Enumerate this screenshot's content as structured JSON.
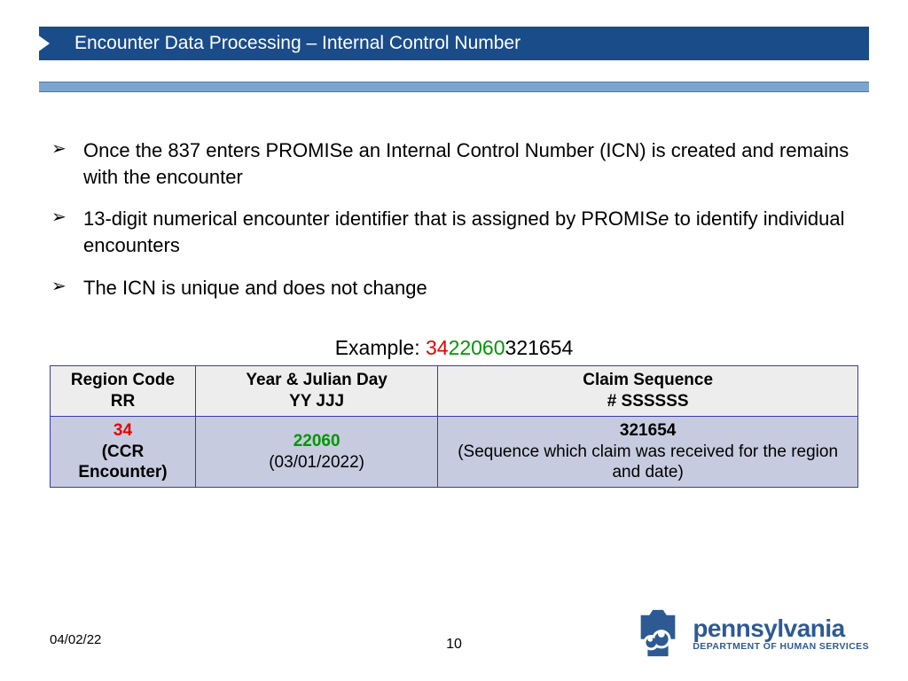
{
  "header": {
    "title": "Encounter Data Processing – Internal Control Number"
  },
  "bullets": {
    "b1": "Once the 837 enters PROMISe an Internal Control Number (ICN) is created and remains with the encounter",
    "b2a": "13-digit numerical encounter identifier that is assigned by PROMIS",
    "b2b": "e",
    "b2c": " to identify individual encounters",
    "b3": "The ICN is unique and does not change"
  },
  "example": {
    "label": "Example: ",
    "p1": "34",
    "p2": "22060",
    "p3": "321654"
  },
  "table": {
    "h1a": "Region Code",
    "h1b": "RR",
    "h2a": "Year & Julian Day",
    "h2b": "YY JJJ",
    "h3a": "Claim Sequence",
    "h3b": "# SSSSSS",
    "c1a": "34",
    "c1b": "(CCR Encounter)",
    "c2a": "22060",
    "c2b": "(03/01/2022)",
    "c3a": "321654",
    "c3b": "(Sequence which claim was received for the region and date)"
  },
  "footer": {
    "date": "04/02/22",
    "page": "10"
  },
  "logo": {
    "top": "pennsylvania",
    "bot": "DEPARTMENT OF HUMAN SERVICES"
  }
}
